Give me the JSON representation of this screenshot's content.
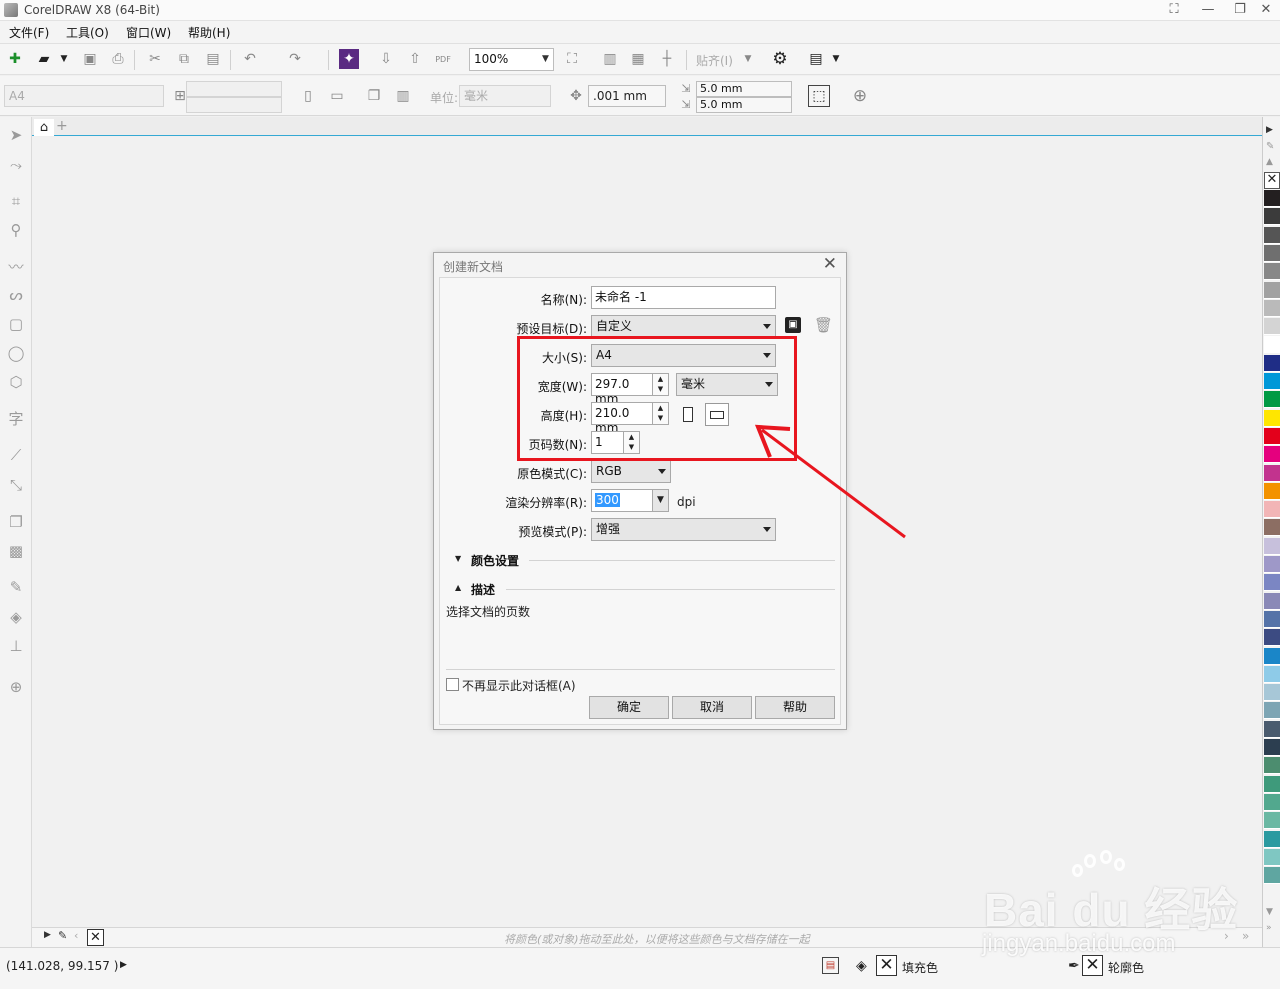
{
  "window": {
    "title": "CorelDRAW X8 (64-Bit)"
  },
  "menu": [
    "文件(F)",
    "工具(O)",
    "窗口(W)",
    "帮助(H)"
  ],
  "toolbar1": {
    "zoom_value": "100%",
    "snap_label": "贴齐(I)"
  },
  "toolbar2": {
    "page_size_value": "A4",
    "unit_label": "单位:",
    "unit_value": "毫米",
    "nudge_value": ".001 mm",
    "dup_x_value": "5.0 mm",
    "dup_y_value": "5.0 mm"
  },
  "dialog": {
    "title": "创建新文档",
    "name_label": "名称(N):",
    "name_value": "未命名 -1",
    "preset_label": "预设目标(D):",
    "preset_value": "自定义",
    "size_label": "大小(S):",
    "size_value": "A4",
    "width_label": "宽度(W):",
    "width_value": "297.0 mm",
    "unit_value": "毫米",
    "height_label": "高度(H):",
    "height_value": "210.0 mm",
    "pages_label": "页码数(N):",
    "pages_value": "1",
    "color_mode_label": "原色模式(C):",
    "color_mode_value": "RGB",
    "resolution_label": "渲染分辨率(R):",
    "resolution_value": "300",
    "resolution_unit": "dpi",
    "preview_label": "预览模式(P):",
    "preview_value": "增强",
    "color_settings_header": "颜色设置",
    "description_header": "描述",
    "description_text": "选择文档的页数",
    "dont_show_label": "不再显示此对话框(A)",
    "ok_label": "确定",
    "cancel_label": "取消",
    "help_label": "帮助"
  },
  "tray": {
    "hint": "将颜色(或对象)拖动至此处，以便将这些颜色与文档存储在一起"
  },
  "status": {
    "coords": "(141.028, 99.157 )",
    "fill_label": "填充色",
    "outline_label": "轮廓色"
  },
  "watermark": {
    "main": "Bai du 经验",
    "sub": "jingyan.baidu.com"
  },
  "palette": [
    "#231f20",
    "#3b3b3b",
    "#555",
    "#6f6f6f",
    "#888",
    "#a1a1a1",
    "#bababa",
    "#d4d4d4",
    "#ffffff",
    "#1f2d86",
    "#0098d8",
    "#009a44",
    "#ffe600",
    "#e3001b",
    "#e5007e",
    "#c2338e",
    "#f39200",
    "#f2b5b6",
    "#8c6e63",
    "#c7c0dc",
    "#9e98c8",
    "#7b86c3",
    "#8a89b7",
    "#5573a8",
    "#3c4b82",
    "#1a86c8",
    "#8ecbe8",
    "#a7c7d7",
    "#7da5b4",
    "#4a5b6e",
    "#2c3e50",
    "#4c8d6f",
    "#3e9a7b",
    "#52a88e",
    "#6ab8a3",
    "#2b9aa0",
    "#7fc7c2",
    "#5fa6a1"
  ],
  "colors": {
    "highlight": "#e8161f",
    "accent_blue": "#35a9d4"
  }
}
